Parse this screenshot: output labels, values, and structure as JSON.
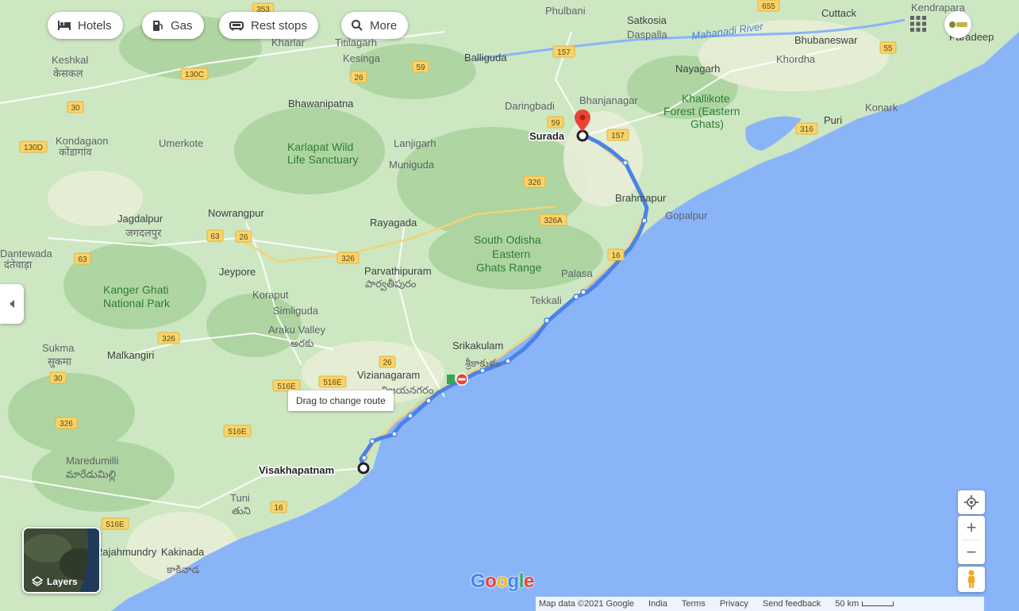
{
  "top_chips": [
    {
      "label": "Hotels",
      "icon": "bed-icon"
    },
    {
      "label": "Gas",
      "icon": "gas-pump-icon"
    },
    {
      "label": "Rest stops",
      "icon": "car-icon"
    },
    {
      "label": "More",
      "icon": "search-icon"
    }
  ],
  "map": {
    "route": {
      "origin": "Visakhapatnam",
      "destination": "Surada",
      "color": "#4a83e8"
    },
    "water_color": "#8ab4f8",
    "land_color": "#cde7c3",
    "places": [
      {
        "text": "Bhawanipatna"
      },
      {
        "text": "Karlapat Wild"
      },
      {
        "text": "Life Sanctuary"
      },
      {
        "text": "Jagdalpur"
      },
      {
        "text": "जगदलपुर"
      },
      {
        "text": "Nowrangpur"
      },
      {
        "text": "Rayagada"
      },
      {
        "text": "Jeypore"
      },
      {
        "text": "Koraput"
      },
      {
        "text": "Simliguda"
      },
      {
        "text": "Araku Valley"
      },
      {
        "text": "Kanger Ghati"
      },
      {
        "text": "National Park"
      },
      {
        "text": "Malkangiri"
      },
      {
        "text": "Sukma"
      },
      {
        "text": "सुकमा"
      },
      {
        "text": "Parvathipuram"
      },
      {
        "text": "South Odisha"
      },
      {
        "text": "Eastern"
      },
      {
        "text": "Ghats Range"
      },
      {
        "text": "Srikakulam"
      },
      {
        "text": "Vizianagaram"
      },
      {
        "text": "Brahmapur"
      },
      {
        "text": "Gopalpur"
      },
      {
        "text": "Palasa"
      },
      {
        "text": "Tekkali"
      },
      {
        "text": "Bhanjanagar"
      },
      {
        "text": "Nayagarh"
      },
      {
        "text": "Khallikote"
      },
      {
        "text": "Forest (Eastern"
      },
      {
        "text": "Ghats)"
      },
      {
        "text": "Puri"
      },
      {
        "text": "Konark"
      },
      {
        "text": "Khordha"
      },
      {
        "text": "Bhubaneswar"
      },
      {
        "text": "Cuttack"
      },
      {
        "text": "Kendrapara"
      },
      {
        "text": "Paradeep"
      },
      {
        "text": "Satkosia"
      },
      {
        "text": "Daspalla"
      },
      {
        "text": "Phulbani"
      },
      {
        "text": "Balliguda"
      },
      {
        "text": "Daringbadi"
      },
      {
        "text": "Lanjigarh"
      },
      {
        "text": "Muniguda"
      },
      {
        "text": "Kesinga"
      },
      {
        "text": "Titilagarh"
      },
      {
        "text": "Kharlar"
      },
      {
        "text": "Keshkal"
      },
      {
        "text": "केसकल"
      },
      {
        "text": "Kondagaon"
      },
      {
        "text": "कोंडागांव"
      },
      {
        "text": "Umerkote"
      },
      {
        "text": "Dantewada"
      },
      {
        "text": "दंतेवाड़ा"
      },
      {
        "text": "Maredumilli"
      },
      {
        "text": "Tuni"
      },
      {
        "text": "Kakinada"
      },
      {
        "text": "Rajahmundry"
      },
      {
        "text": "Mahanadi River"
      },
      {
        "text": "Visakhapatnam"
      },
      {
        "text": "Surada"
      },
      {
        "text": "శ్రీకాకుళం"
      },
      {
        "text": "పార్వతీపురం"
      },
      {
        "text": "విజయనగరం"
      },
      {
        "text": "అరకు"
      },
      {
        "text": "కాకినాడ"
      },
      {
        "text": "మారేడుమిల్లి"
      },
      {
        "text": "తుని"
      }
    ],
    "highway_shields": [
      "353",
      "655",
      "130C",
      "26",
      "59",
      "157",
      "59",
      "157",
      "55",
      "30",
      "130D",
      "326",
      "326A",
      "16",
      "326",
      "63",
      "26",
      "63",
      "326",
      "26",
      "516E",
      "516E",
      "516E",
      "30",
      "326",
      "516E",
      "16",
      "316"
    ]
  },
  "tooltip": "Drag to change route",
  "layers_label": "Layers",
  "google_logo": {
    "letters": [
      "G",
      "o",
      "o",
      "g",
      "l",
      "e"
    ],
    "colors": [
      "#4285f4",
      "#ea4335",
      "#fbbc05",
      "#4285f4",
      "#34a853",
      "#ea4335"
    ]
  },
  "attribution": {
    "map_data": "Map data ©2021 Google",
    "country": "India",
    "terms": "Terms",
    "privacy": "Privacy",
    "feedback": "Send feedback",
    "scale": "50 km"
  },
  "controls": {
    "zoom_in": "+",
    "zoom_out": "−"
  }
}
